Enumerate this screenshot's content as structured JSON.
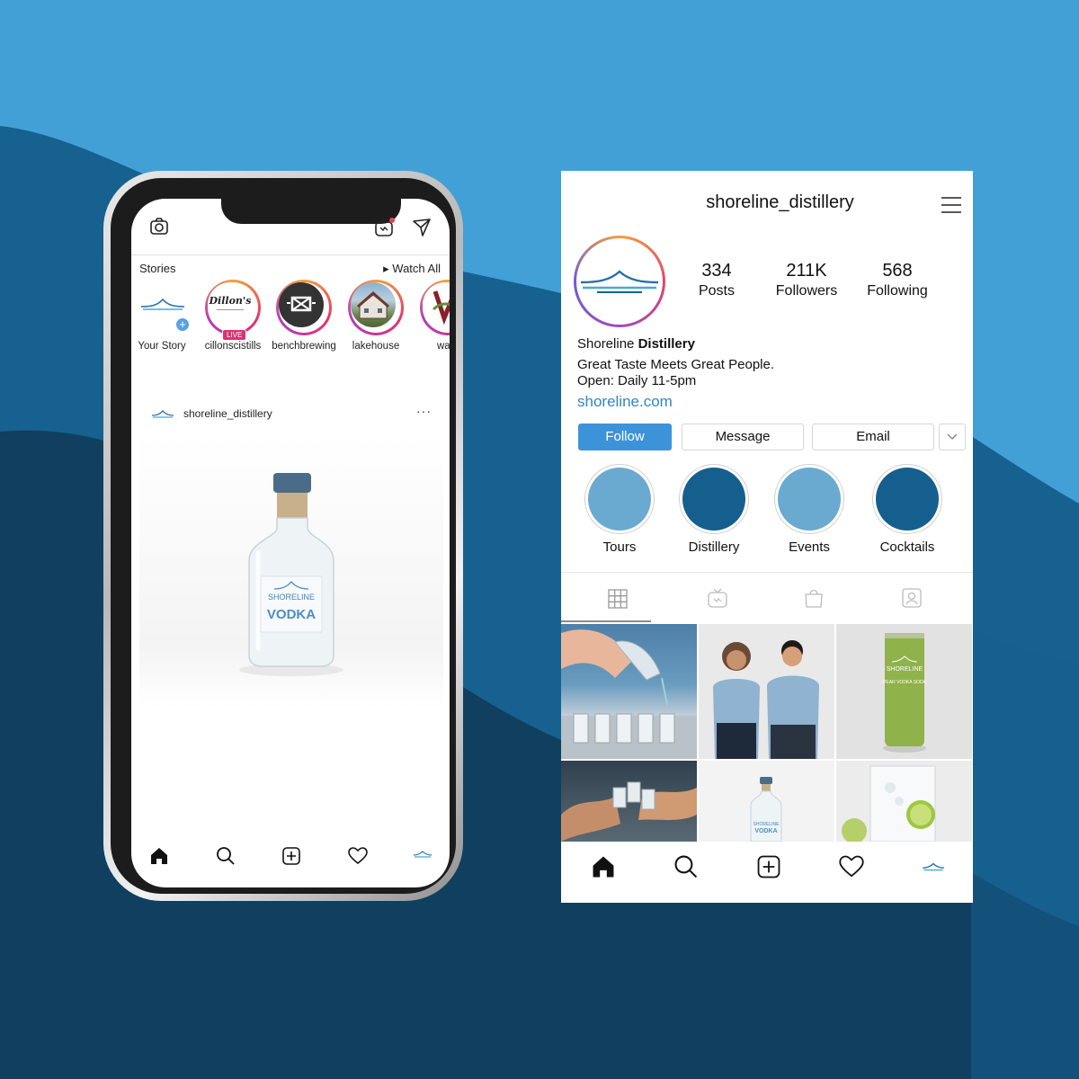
{
  "phone": {
    "stories_label": "Stories",
    "watch_all": "▸ Watch All",
    "stories": [
      {
        "label": "Your Story"
      },
      {
        "label": "cillonscistills",
        "badge": "LIVE",
        "logo_text": "Dillon's"
      },
      {
        "label": "benchbrewing"
      },
      {
        "label": "lakehouse"
      },
      {
        "label": "wa"
      }
    ],
    "post": {
      "username": "shoreline_distillery",
      "more": "···",
      "bottle_brand": "SHORELINE",
      "bottle_product": "VODKA"
    },
    "nav_icons": [
      "home-icon",
      "search-icon",
      "add-post-icon",
      "heart-icon",
      "profile-logo-icon"
    ]
  },
  "profile": {
    "username": "shoreline_distillery",
    "stats": [
      {
        "value": "334",
        "label": "Posts"
      },
      {
        "value": "211K",
        "label": "Followers"
      },
      {
        "value": "568",
        "label": "Following"
      }
    ],
    "name_light": "Shoreline",
    "name_bold": "Distillery",
    "bio_line1": "Great Taste Meets Great People.",
    "bio_line2": "Open: Daily 11-5pm",
    "link": "shoreline.com",
    "buttons": {
      "follow": "Follow",
      "message": "Message",
      "email": "Email"
    },
    "highlights": [
      {
        "label": "Tours",
        "color": "#6aaad0"
      },
      {
        "label": "Distillery",
        "color": "#155f8f"
      },
      {
        "label": "Events",
        "color": "#6aaad0"
      },
      {
        "label": "Cocktails",
        "color": "#155f8f"
      }
    ],
    "can_brand": "SHORELINE",
    "can_product": "PEAR VODKA SODA",
    "mini_bottle_brand": "SHORELINE",
    "mini_bottle_product": "VODKA"
  },
  "colors": {
    "background_light": "#43a0d6",
    "background_mid": "#15618f",
    "background_dark": "#0f3f5f",
    "follow_button": "#3d93da",
    "link": "#2f86c9"
  }
}
